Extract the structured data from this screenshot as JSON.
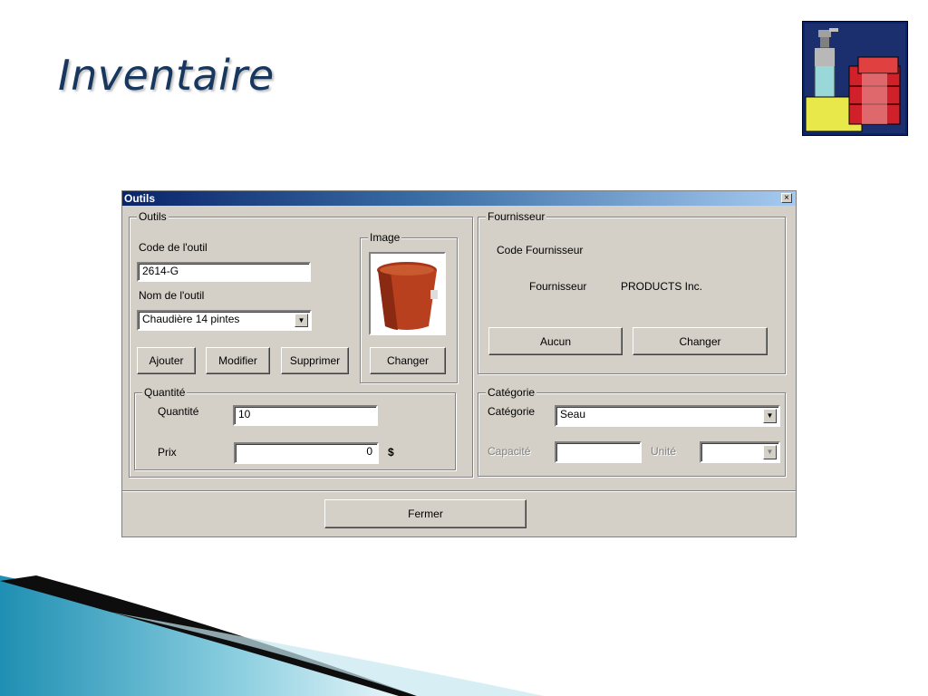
{
  "slide": {
    "title": "Inventaire"
  },
  "dialog": {
    "title": "Outils",
    "close_glyph": "×",
    "outils_group": {
      "legend": "Outils",
      "code_label": "Code de l'outil",
      "code_value": "2614-G",
      "name_label": "Nom de l'outil",
      "name_value": "Chaudière 14 pintes",
      "buttons": {
        "add": "Ajouter",
        "modify": "Modifier",
        "delete": "Supprimer"
      }
    },
    "image_group": {
      "legend": "Image",
      "change_button": "Changer"
    },
    "quantite_group": {
      "legend": "Quantité",
      "qty_label": "Quantité",
      "qty_value": "10",
      "price_label": "Prix",
      "price_value": "0",
      "currency": "$"
    },
    "fournisseur_group": {
      "legend": "Fournisseur",
      "code_label": "Code Fournisseur",
      "supplier_label": "Fournisseur",
      "supplier_value": "PRODUCTS Inc.",
      "none_button": "Aucun",
      "change_button": "Changer"
    },
    "categorie_group": {
      "legend": "Catégorie",
      "cat_label": "Catégorie",
      "cat_value": "Seau",
      "capacity_label": "Capacité",
      "capacity_value": "",
      "unit_label": "Unité",
      "unit_value": ""
    },
    "close_button": "Fermer"
  },
  "icons": {
    "logo": "chemical-products-logo-icon",
    "bucket": "bucket-image-icon",
    "dropdown": "dropdown-arrow-icon"
  },
  "colors": {
    "title": "#17375e",
    "titlebar_start": "#0a246a",
    "titlebar_end": "#a6caf0",
    "dialog_bg": "#d4d0c8",
    "swoosh": "#1f8fb3"
  }
}
